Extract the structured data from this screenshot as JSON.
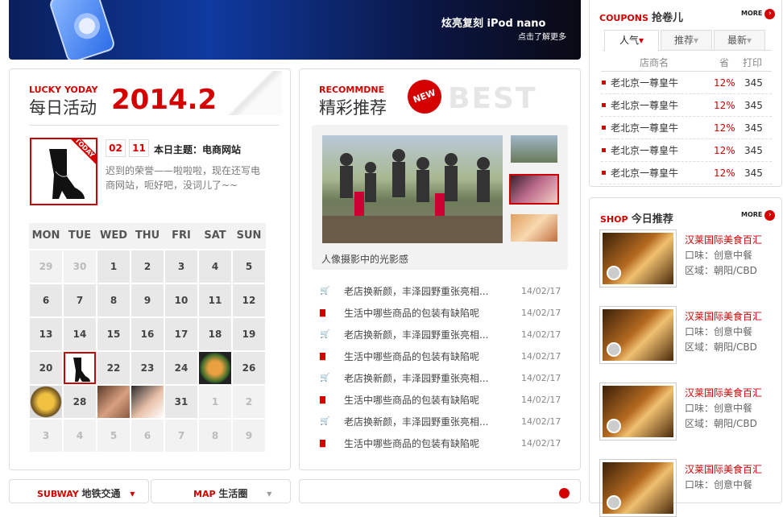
{
  "banner": {
    "slogan": "炫亮复刻  iPod nano",
    "cta": "点击了解更多"
  },
  "daily": {
    "en": "LUCKY YODAY",
    "cn": "每日活动",
    "date": "2014.2",
    "today_tag": "TODAY",
    "month": "02",
    "day": "11",
    "theme_label": "本日主题：电商网站",
    "desc": "迟到的荣誉——啦啦啦，现在还写电商网站，呃好吧，没词儿了~~",
    "weekdays": [
      "MON",
      "TUE",
      "WED",
      "THU",
      "FRI",
      "SAT",
      "SUN"
    ],
    "weeks": [
      [
        "29",
        "30",
        "1",
        "2",
        "3",
        "4",
        "5"
      ],
      [
        "6",
        "7",
        "8",
        "9",
        "10",
        "11",
        "12"
      ],
      [
        "13",
        "14",
        "15",
        "16",
        "17",
        "18",
        "19"
      ],
      [
        "20",
        "",
        "22",
        "23",
        "24",
        "",
        "26"
      ],
      [
        "",
        "28",
        "",
        "",
        "31",
        "1",
        "2"
      ],
      [
        "3",
        "4",
        "5",
        "6",
        "7",
        "8",
        "9"
      ]
    ]
  },
  "recommend": {
    "en": "RECOMMDNE",
    "cn": "精彩推荐",
    "badge": "NEW",
    "watermark": "BEST",
    "caption": "人像摄影中的光影感",
    "items": [
      {
        "icon": "cart-icon",
        "text": "老店换新颜，丰泽园野重张亮相...",
        "date": "14/02/17"
      },
      {
        "icon": "doc-icon",
        "text": "生活中哪些商品的包装有缺陷呢",
        "date": "14/02/17"
      },
      {
        "icon": "cart-icon",
        "text": "老店换新颜，丰泽园野重张亮相...",
        "date": "14/02/17"
      },
      {
        "icon": "doc-icon",
        "text": "生活中哪些商品的包装有缺陷呢",
        "date": "14/02/17"
      },
      {
        "icon": "cart-icon",
        "text": "老店换新颜，丰泽园野重张亮相...",
        "date": "14/02/17"
      },
      {
        "icon": "doc-icon",
        "text": "生活中哪些商品的包装有缺陷呢",
        "date": "14/02/17"
      },
      {
        "icon": "cart-icon",
        "text": "老店换新颜，丰泽园野重张亮相...",
        "date": "14/02/17"
      },
      {
        "icon": "doc-icon",
        "text": "生活中哪些商品的包装有缺陷呢",
        "date": "14/02/17"
      }
    ]
  },
  "coupons": {
    "en": "COUPONS",
    "cn": "抢卷儿",
    "more": "MORE",
    "tabs": [
      "人气",
      "推荐",
      "最新"
    ],
    "headers": [
      "店商名",
      "省",
      "打印"
    ],
    "rows": [
      {
        "name": "老北京一尊皇牛",
        "save": "12%",
        "print": "345"
      },
      {
        "name": "老北京一尊皇牛",
        "save": "12%",
        "print": "345"
      },
      {
        "name": "老北京一尊皇牛",
        "save": "12%",
        "print": "345"
      },
      {
        "name": "老北京一尊皇牛",
        "save": "12%",
        "print": "345"
      },
      {
        "name": "老北京一尊皇牛",
        "save": "12%",
        "print": "345"
      }
    ]
  },
  "shop": {
    "en": "SHOP",
    "cn": "今日推荐",
    "more": "MORE",
    "items": [
      {
        "name": "汉莱国际美食百汇",
        "taste": "口味：创意中餐",
        "area": "区域：朝阳/CBD"
      },
      {
        "name": "汉莱国际美食百汇",
        "taste": "口味：创意中餐",
        "area": "区域：朝阳/CBD"
      },
      {
        "name": "汉莱国际美食百汇",
        "taste": "口味：创意中餐",
        "area": "区域：朝阳/CBD"
      },
      {
        "name": "汉莱国际美食百汇",
        "taste": "口味：创意中餐",
        "area": ""
      }
    ]
  },
  "bottom": {
    "subway_en": "SUBWAY",
    "subway_cn": "地铁交通",
    "map_en": "MAP",
    "map_cn": "生活圈"
  }
}
